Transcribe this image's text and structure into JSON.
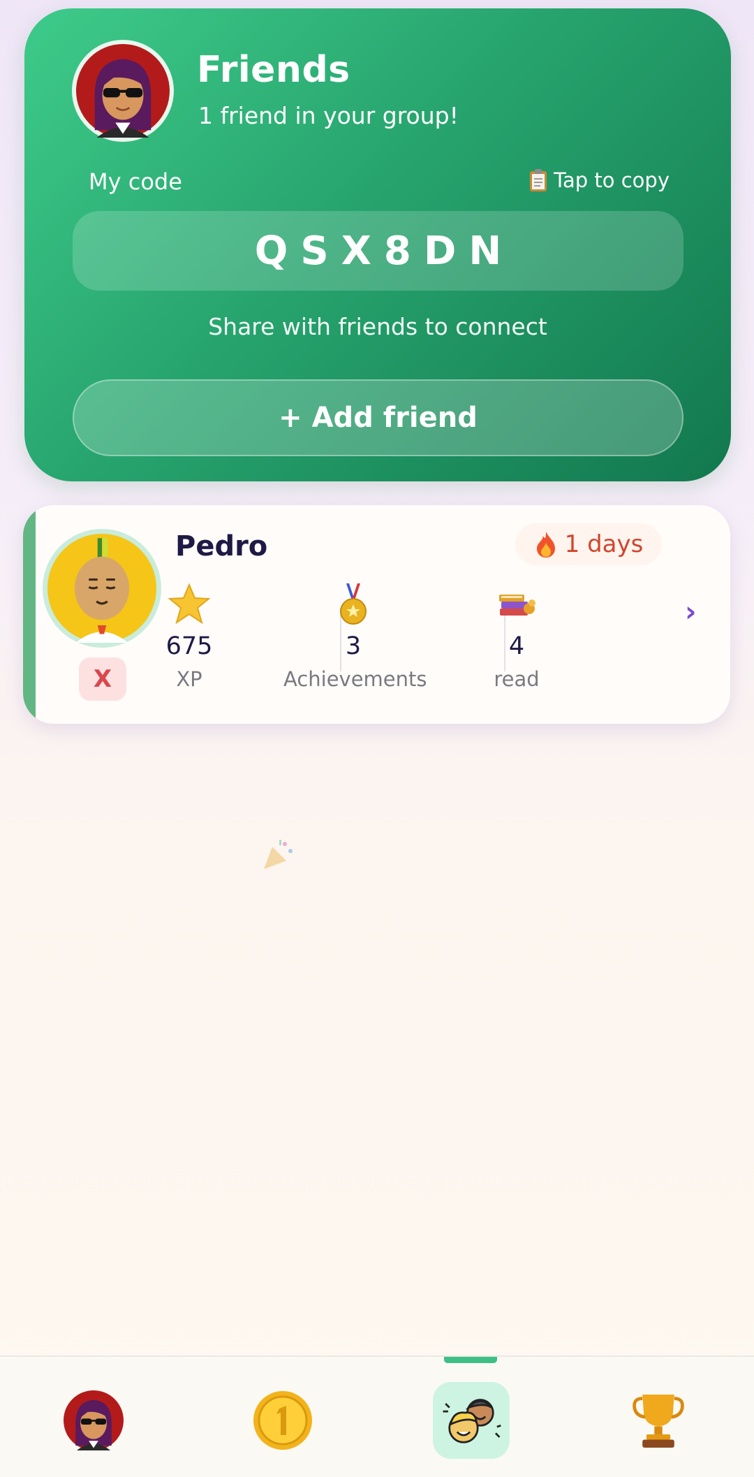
{
  "header": {
    "title": "Friends",
    "subtitle": "1 friend in your group!",
    "code_label": "My code",
    "copy_label": "Tap to copy",
    "code": "QSX8DN",
    "share_text": "Share with friends to connect",
    "add_button_label": "+ Add friend"
  },
  "friend": {
    "name": "Pedro",
    "streak": "1 days",
    "remove_label": "X",
    "stats": [
      {
        "value": "675",
        "label": "XP",
        "icon": "star-icon"
      },
      {
        "value": "3",
        "label": "Achievements",
        "icon": "medal-icon"
      },
      {
        "value": "4",
        "label": "read",
        "icon": "books-icon"
      }
    ],
    "chevron": "›"
  },
  "nav": {
    "items": [
      "profile-avatar",
      "coin",
      "friends",
      "trophy"
    ],
    "active": "friends"
  },
  "colors": {
    "accent_green": "#27a46e",
    "accent_purple": "#7a4bd0",
    "streak_red": "#d1452d",
    "name_navy": "#1e1a45"
  }
}
